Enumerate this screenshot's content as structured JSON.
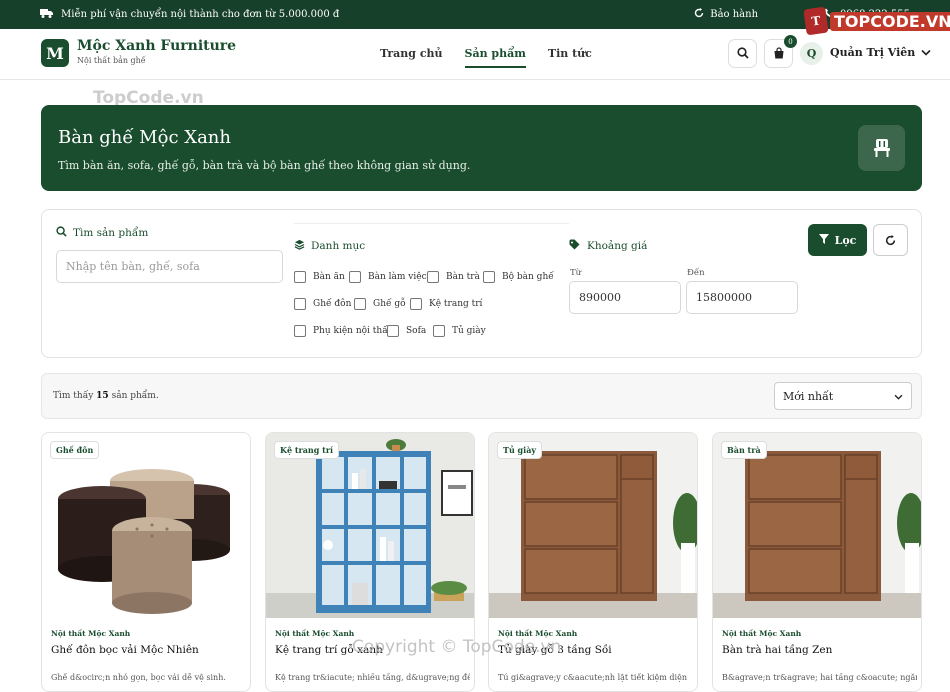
{
  "topbar": {
    "shipping": "Miễn phí vận chuyển nội thành cho đơn từ 5.000.000 đ",
    "warranty": "Bảo hành",
    "phone": "0968.222.555"
  },
  "watermark": {
    "top_logo": "TOPCODE.VN",
    "left": "TopCode.vn",
    "bottom": "Copyright © TopCode.vn"
  },
  "brand": {
    "logo_letter": "M",
    "name": "Mộc Xanh Furniture",
    "tagline": "Nội thất bản ghế"
  },
  "menu": [
    {
      "label": "Trang chủ"
    },
    {
      "label": "Sản phẩm"
    },
    {
      "label": "Tin tức"
    }
  ],
  "cart": {
    "count": "0"
  },
  "user": {
    "initial": "Q",
    "name": "Quản Trị Viên"
  },
  "hero": {
    "title": "Bàn ghế Mộc Xanh",
    "subtitle": "Tìm bàn ăn, sofa, ghế gỗ, bàn trà và bộ bàn ghế theo không gian sử dụng."
  },
  "filter": {
    "search_label": "Tìm sản phẩm",
    "search_placeholder": "Nhập tên bàn, ghế, sofa",
    "category_label": "Danh mục",
    "categories": [
      "Bàn ăn",
      "Bàn làm việc",
      "Bàn trà",
      "Bộ bàn ghế",
      "Ghế đôn",
      "Ghế gỗ",
      "Kệ trang trí",
      "Phụ kiện nội thất",
      "Sofa",
      "Tủ giày"
    ],
    "price_label": "Khoảng giá",
    "from_label": "Từ",
    "to_label": "Đến",
    "price_from": "890000",
    "price_to": "15800000",
    "filter_button": "Lọc"
  },
  "results": {
    "prefix": "Tìm thấy",
    "count": "15",
    "suffix": "sản phẩm.",
    "sort_selected": "Mới nhất"
  },
  "products": [
    {
      "badge": "Ghế đôn",
      "category": "Nội thất Mộc Xanh",
      "name": "Ghế đôn bọc vải Mộc Nhiên",
      "desc": "Ghế d&ocirc;n nhỏ gọn, bọc vải dễ vệ sinh."
    },
    {
      "badge": "Kệ trang trí",
      "category": "Nội thất Mộc Xanh",
      "name": "Kệ trang trí gỗ xanh",
      "desc": "Kệ trang tr&iacute; nhiều tầng, d&ugrave;ng để"
    },
    {
      "badge": "Tủ giày",
      "category": "Nội thất Mộc Xanh",
      "name": "Tủ giày gỗ 3 tầng Sồi",
      "desc": "Tủ gi&agrave;y c&aacute;nh lật tiết kiệm diện"
    },
    {
      "badge": "Bàn trà",
      "category": "Nội thất Mộc Xanh",
      "name": "Bàn trà hai tầng Zen",
      "desc": "B&agrave;n tr&agrave; hai tầng c&oacute; ngăn để"
    }
  ],
  "colors": {
    "primary": "#1a4d2e",
    "topbar": "#17402a"
  }
}
